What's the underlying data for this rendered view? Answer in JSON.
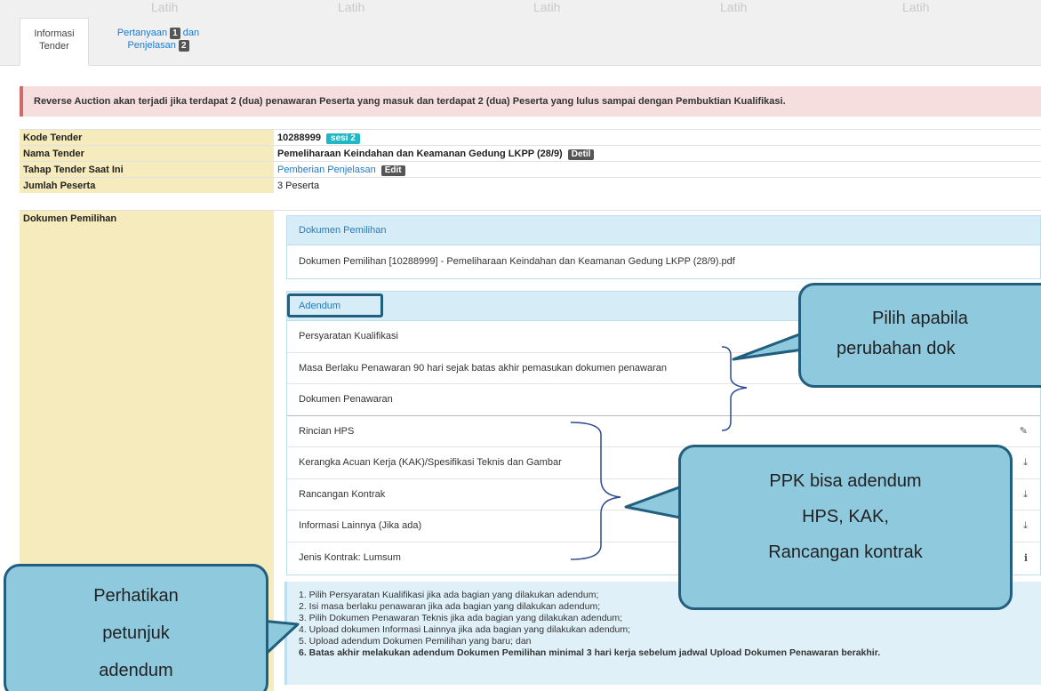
{
  "watermark": "Latih",
  "tabs": [
    {
      "label_line1": "Informasi",
      "label_line2": "Tender"
    },
    {
      "label_line1": "Pertanyaan",
      "badge1": "1",
      "conj": "dan",
      "label_line2": "Penjelasan",
      "badge2": "2"
    }
  ],
  "alert_text": "Reverse Auction akan terjadi jika terdapat 2 (dua) penawaran Peserta yang masuk dan terdapat 2 (dua) Peserta yang lulus sampai dengan Pembuktian Kualifikasi.",
  "info": {
    "kode_label": "Kode Tender",
    "kode_value": "10288999",
    "kode_badge": "sesi 2",
    "nama_label": "Nama Tender",
    "nama_value": "Pemeliharaan Keindahan dan Keamanan Gedung LKPP (28/9)",
    "nama_badge": "Detil",
    "tahap_label": "Tahap Tender Saat Ini",
    "tahap_value": "Pemberian Penjelasan",
    "tahap_badge": "Edit",
    "jumlah_label": "Jumlah Peserta",
    "jumlah_value": "3 Peserta",
    "dok_label": "Dokumen Pemilihan"
  },
  "dokumen_panel": {
    "title": "Dokumen Pemilihan",
    "file": "Dokumen Pemilihan [10288999] - Pemeliharaan Keindahan dan Keamanan Gedung LKPP (28/9).pdf"
  },
  "adendum_panel": {
    "title": "Adendum",
    "items": [
      {
        "label": "Persyaratan Kualifikasi",
        "icon": ""
      },
      {
        "label": "Masa Berlaku Penawaran 90 hari sejak batas akhir pemasukan dokumen penawaran",
        "icon": ""
      },
      {
        "label": "Dokumen Penawaran",
        "icon": ""
      },
      {
        "label": "Rincian HPS",
        "icon": "edit-icon"
      },
      {
        "label": "Kerangka Acuan Kerja (KAK)/Spesifikasi Teknis dan Gambar",
        "icon": "upload-icon"
      },
      {
        "label": "Rancangan Kontrak",
        "icon": "upload-icon"
      },
      {
        "label": "Informasi Lainnya (Jika ada)",
        "icon": "upload-icon"
      },
      {
        "label": "Jenis Kontrak: Lumsum",
        "icon": "info-icon"
      }
    ]
  },
  "hints": [
    "1. Pilih Persyaratan Kualifikasi jika ada bagian yang dilakukan adendum;",
    "2. Isi masa berlaku penawaran jika ada bagian yang dilakukan adendum;",
    "3. Pilih Dokumen Penawaran Teknis jika ada bagian yang dilakukan adendum;",
    "4. Upload dokumen Informasi Lainnya jika ada bagian yang dilakukan adendum;",
    "5. Upload adendum Dokumen Pemilihan yang baru; dan",
    "6. Batas akhir melakukan adendum Dokumen Pemilihan minimal 3 hari kerja sebelum jadwal Upload Dokumen Penawaran berakhir."
  ],
  "callouts": {
    "top_line1": "Pilih apabila",
    "top_line2": "perubahan dok",
    "mid_line1": "PPK bisa adendum",
    "mid_line2": "HPS, KAK,",
    "mid_line3": "Rancangan kontrak",
    "left_line1": "Perhatikan",
    "left_line2": "petunjuk",
    "left_line3": "adendum"
  }
}
